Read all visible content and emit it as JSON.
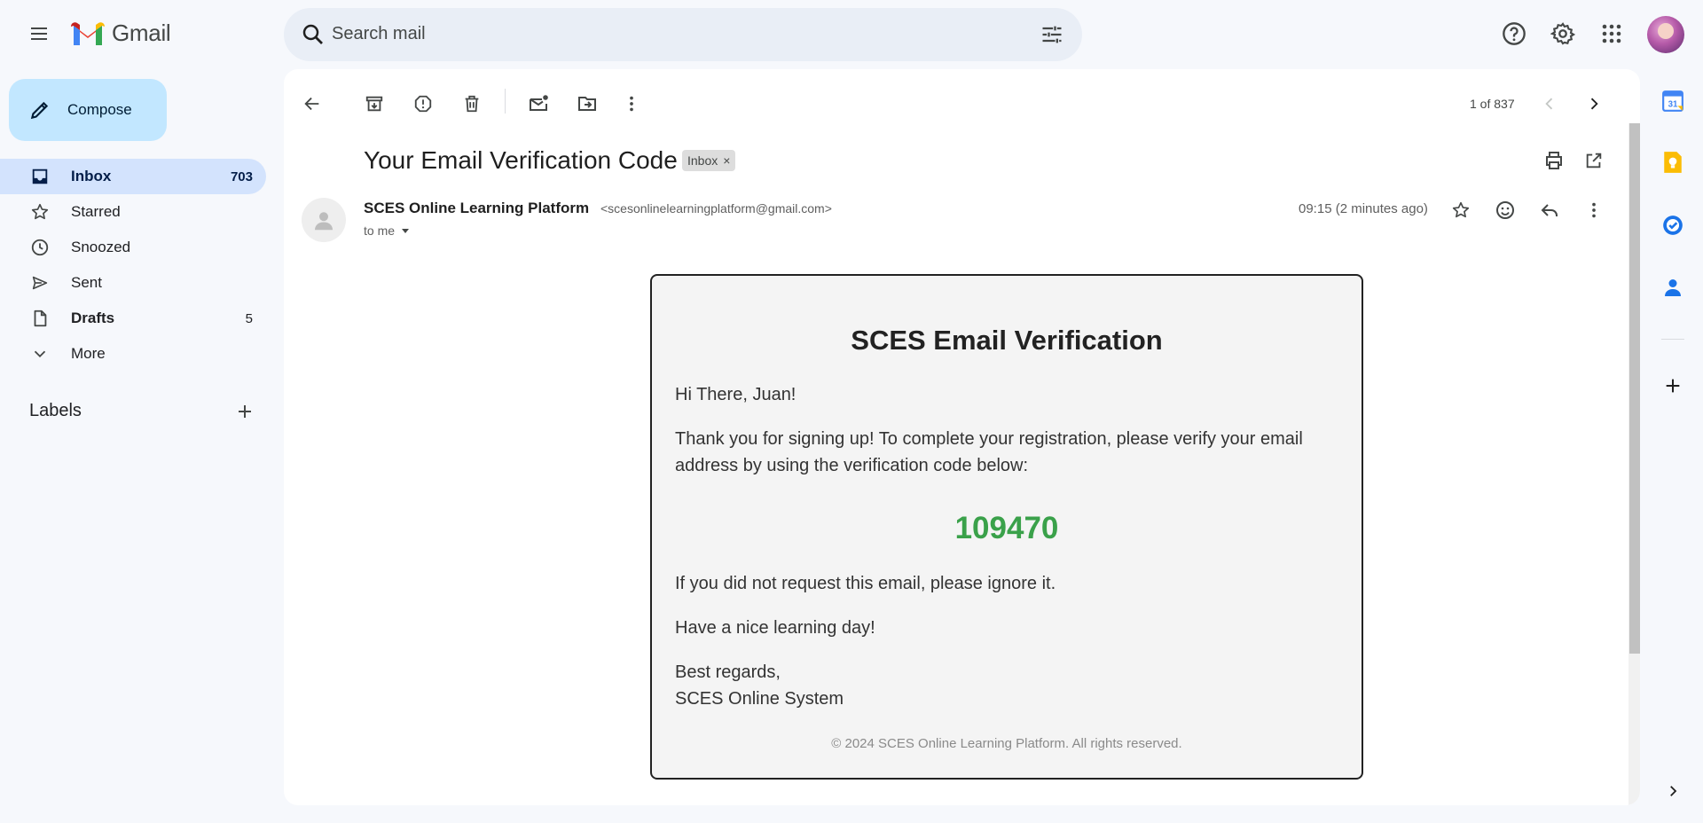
{
  "app": {
    "name": "Gmail"
  },
  "search": {
    "placeholder": "Search mail"
  },
  "sidebar": {
    "compose_label": "Compose",
    "items": [
      {
        "label": "Inbox",
        "count": "703",
        "icon": "inbox-icon"
      },
      {
        "label": "Starred",
        "count": "",
        "icon": "star-icon"
      },
      {
        "label": "Snoozed",
        "count": "",
        "icon": "clock-icon"
      },
      {
        "label": "Sent",
        "count": "",
        "icon": "send-icon"
      },
      {
        "label": "Drafts",
        "count": "5",
        "icon": "draft-icon"
      },
      {
        "label": "More",
        "count": "",
        "icon": "chevron-down-icon"
      }
    ],
    "labels_heading": "Labels"
  },
  "toolbar": {
    "pager": "1 of 837"
  },
  "message": {
    "subject": "Your Email Verification Code",
    "label_chip": "Inbox",
    "sender_name": "SCES Online Learning Platform",
    "sender_email": "<scesonlinelearningplatform@gmail.com>",
    "recipient": "to me",
    "time": "09:15 (2 minutes ago)"
  },
  "email_body": {
    "title": "SCES Email Verification",
    "greeting": "Hi There, Juan!",
    "intro": "Thank you for signing up! To complete your registration, please verify your email address by using the verification code below:",
    "code": "109470",
    "ignore_note": "If you did not request this email, please ignore it.",
    "closing_wish": "Have a nice learning day!",
    "sign_off": "Best regards,",
    "signature": "SCES Online System",
    "footer": "© 2024 SCES Online Learning Platform. All rights reserved."
  },
  "colors": {
    "background": "#f6f8fc",
    "compose": "#c2e7ff",
    "active_nav": "#d3e3fd",
    "search_bg": "#e9eef6",
    "code_green": "#3aa14a"
  }
}
